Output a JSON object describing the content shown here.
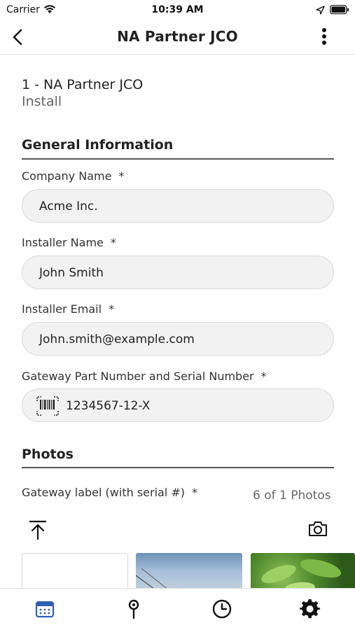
{
  "status_bar": {
    "carrier": "Carrier",
    "time": "10:39 AM"
  },
  "nav": {
    "title": "NA Partner JCO",
    "icons": [
      "back-chevron-icon",
      "more-vertical-icon"
    ]
  },
  "header": {
    "title": "1 - NA Partner JCO",
    "subtitle": "Install"
  },
  "general_info": {
    "section_title": "General Information",
    "fields": [
      {
        "label": "Company Name",
        "required_mark": "*",
        "value": "Acme Inc."
      },
      {
        "label": "Installer Name",
        "required_mark": "*",
        "value": "John Smith"
      },
      {
        "label": "Installer Email",
        "required_mark": "*",
        "value": "John.smith@example.com"
      },
      {
        "label": "Gateway Part Number and Serial Number",
        "required_mark": "*",
        "value": "1234567-12-X",
        "icon": "barcode-scan-icon"
      }
    ]
  },
  "photos": {
    "section_title": "Photos",
    "label": "Gateway label (with serial #)",
    "required_mark": "*",
    "count_text": "6 of 1 Photos",
    "icons": [
      "upload-icon",
      "camera-icon"
    ]
  },
  "tab_bar": {
    "tabs": [
      "calendar-icon",
      "location-pin-icon",
      "clock-icon",
      "gear-icon"
    ],
    "active_color": "#2f5fb3",
    "inactive_color": "#111111"
  },
  "colors": {
    "accent": "#2f5fb3",
    "input_background": "#f2f2f2"
  }
}
